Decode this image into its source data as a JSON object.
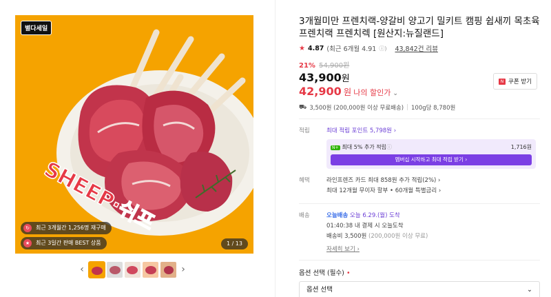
{
  "gallery": {
    "logo_text": "별다세일",
    "badge_reorder": "최근 3개월간 1,256명 재구매",
    "badge_best": "최근 3일간 판매 BEST 상품",
    "counter": "1 / 13",
    "overlay_text": "SHEEP·쉬프",
    "prev_arrow": "‹",
    "next_arrow": "›",
    "thumbnails": 5,
    "selected_thumbnail": 1
  },
  "product": {
    "title": "3개월미만 프렌치랙-양갈비 양고기 밀키트 캠핑 쉽새끼 목초육 프렌치랙 프렌치렉 [원산지:뉴질랜드]",
    "rating_value": "4.87",
    "rating_recent": "(최근 6개월 4.91",
    "review_count": "43,842건 리뷰",
    "discount_pct": "21%",
    "original_price": "54,900원",
    "price": "43,900",
    "price_unit": "원",
    "my_price": "42,900",
    "my_price_unit": "원",
    "my_price_label": "나의 할인가",
    "coupon_label": "쿠폰 받기",
    "shipping_info": "3,500원 (200,000원 이상 무료배송)",
    "unit_price": "100g당 8,780원"
  },
  "points": {
    "label": "적립",
    "max_points": "최대 적립 포인트 5,798원",
    "extra_label": "최대 5% 추가 적립",
    "extra_amount": "1,716원",
    "membership_button": "멤버십 시작하고 최대 적립 받기"
  },
  "benefits": {
    "label": "혜택",
    "line1": "라인프렌즈 카드 최대 858원 추가 적립(2%)",
    "line2": "최대 12개월 무이자 할부 • 60개월 특별금리"
  },
  "delivery": {
    "label": "배송",
    "today_tag": "오늘배송",
    "today_date": "오늘 6.29.(월) 도착",
    "cutoff": "01:40:38  내 결제 시 오늘도착",
    "fee": "배송비 3,500원",
    "fee_note": "(200,000원 이상 무료)",
    "more_link": "자세히 보기"
  },
  "options": {
    "label": "옵션 선택 (필수)",
    "required_mark": "•",
    "select_value": "옵션 선택"
  },
  "colors": {
    "accent_red": "#e63946",
    "accent_purple": "#6c3fd6",
    "image_bg": "#f5a300"
  }
}
